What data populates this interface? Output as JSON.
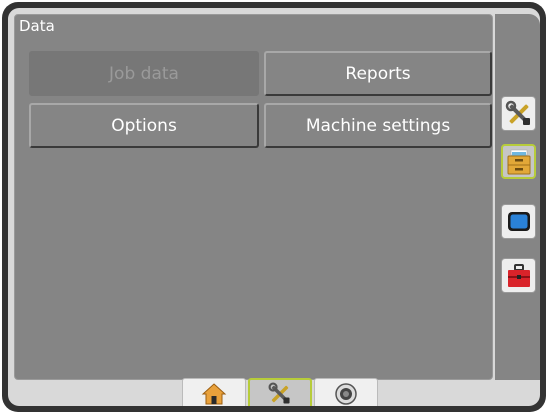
{
  "panel": {
    "title": "Data",
    "buttons": [
      {
        "label": "Job data",
        "state": "disabled"
      },
      {
        "label": "Reports",
        "state": "enabled"
      },
      {
        "label": "Options",
        "state": "enabled"
      },
      {
        "label": "Machine settings",
        "state": "enabled"
      }
    ]
  },
  "side_tabs": [
    {
      "icon": "tools-icon",
      "active": false
    },
    {
      "icon": "data-cabinet-icon",
      "active": true
    },
    {
      "icon": "console-icon",
      "active": false
    },
    {
      "icon": "toolbox-icon",
      "active": false
    }
  ],
  "bottom_tabs": [
    {
      "icon": "home-icon",
      "active": false
    },
    {
      "icon": "tools-icon",
      "active": true
    },
    {
      "icon": "camera-icon",
      "active": false
    }
  ],
  "colors": {
    "accent_active": "#b7cc3a",
    "panel_bg": "#858585",
    "frame": "#333333"
  }
}
